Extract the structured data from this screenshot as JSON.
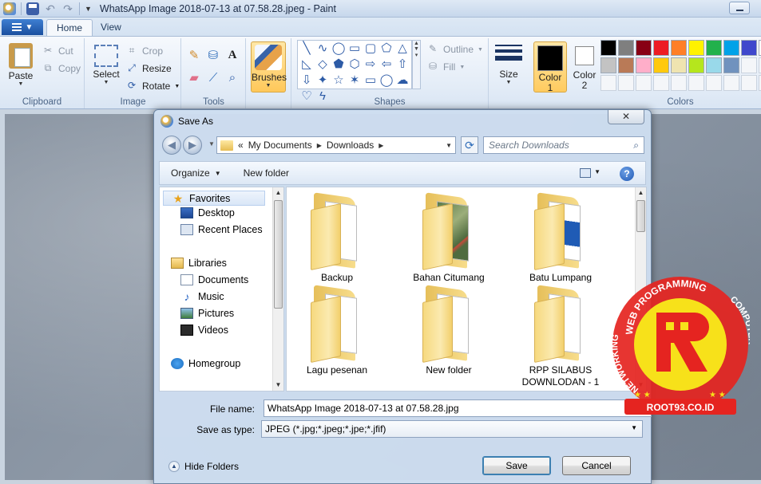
{
  "window": {
    "title": "WhatsApp Image 2018-07-13 at 07.58.28.jpeg - Paint"
  },
  "ribbon_tabs": [
    {
      "label": "Home"
    },
    {
      "label": "View"
    }
  ],
  "clipboard": {
    "paste": "Paste",
    "cut": "Cut",
    "copy": "Copy",
    "group": "Clipboard"
  },
  "image": {
    "select": "Select",
    "crop": "Crop",
    "resize": "Resize",
    "rotate": "Rotate",
    "group": "Image"
  },
  "tools": {
    "group": "Tools",
    "brushes": "Brushes"
  },
  "shapes": {
    "group": "Shapes",
    "outline": "Outline",
    "fill": "Fill",
    "icons": [
      "line-icon",
      "curve-icon",
      "oval-icon",
      "rectangle-icon",
      "rounded-rectangle-icon",
      "polygon-icon",
      "triangle-icon",
      "right-triangle-icon",
      "diamond-icon",
      "pentagon-icon",
      "hexagon-icon",
      "right-arrow-icon",
      "left-arrow-icon",
      "up-arrow-icon",
      "down-arrow-icon",
      "four-point-star-icon",
      "five-point-star-icon",
      "six-point-star-icon",
      "callout-rect-icon",
      "callout-oval-icon",
      "callout-cloud-icon",
      "heart-icon",
      "lightning-icon"
    ]
  },
  "size": {
    "label": "Size"
  },
  "colors": {
    "color1": "Color\n1",
    "color1_line1": "Color",
    "color1_line2": "1",
    "color2_line1": "Color",
    "color2_line2": "2",
    "group": "Colors",
    "color1_value": "#000000",
    "color2_value": "#ffffff",
    "palette": [
      "#000000",
      "#7f7f7f",
      "#880015",
      "#ed1c24",
      "#ff7f27",
      "#fff200",
      "#22b14c",
      "#00a2e8",
      "#3f48cc",
      "#ffffff",
      "#c3c3c3",
      "#b97a57",
      "#ffaec9",
      "#ffc90e",
      "#efe4b0",
      "#b5e61d",
      "#99d9ea",
      "#7092be"
    ]
  },
  "dialog": {
    "title": "Save As",
    "close": "✕",
    "breadcrumb_prefix": "«",
    "breadcrumb": [
      "My Documents",
      "Downloads"
    ],
    "search_placeholder": "Search Downloads",
    "organize": "Organize",
    "new_folder": "New folder",
    "nav_tree": [
      {
        "label": "Favorites",
        "icon": "star-icon"
      },
      {
        "label": "Desktop",
        "icon": "desktop-icon"
      },
      {
        "label": "Recent Places",
        "icon": "recent-places-icon"
      },
      {
        "label": "Libraries",
        "icon": "libraries-icon"
      },
      {
        "label": "Documents",
        "icon": "documents-icon"
      },
      {
        "label": "Music",
        "icon": "music-icon"
      },
      {
        "label": "Pictures",
        "icon": "pictures-icon"
      },
      {
        "label": "Videos",
        "icon": "videos-icon"
      },
      {
        "label": "Homegroup",
        "icon": "homegroup-icon"
      }
    ],
    "folders": [
      {
        "name": "Backup"
      },
      {
        "name": "Bahan Citumang"
      },
      {
        "name": "Batu Lumpang"
      },
      {
        "name": "Lagu pesenan"
      },
      {
        "name": "New folder"
      },
      {
        "name": "RPP SILABUS DOWNLODAN - 1"
      }
    ],
    "file_name_label": "File name:",
    "file_name_value": "WhatsApp Image 2018-07-13 at 07.58.28.jpg",
    "save_type_label": "Save as type:",
    "save_type_value": "JPEG (*.jpg;*.jpeg;*.jpe;*.jfif)",
    "hide_folders": "Hide Folders",
    "save_button": "Save",
    "cancel_button": "Cancel"
  },
  "watermark": {
    "top_text": "WEB PROGRAMMING",
    "left_text": "NETWORKING",
    "right_text": "COMPUTER",
    "bottom_text": "ROOT93.CO.ID"
  }
}
